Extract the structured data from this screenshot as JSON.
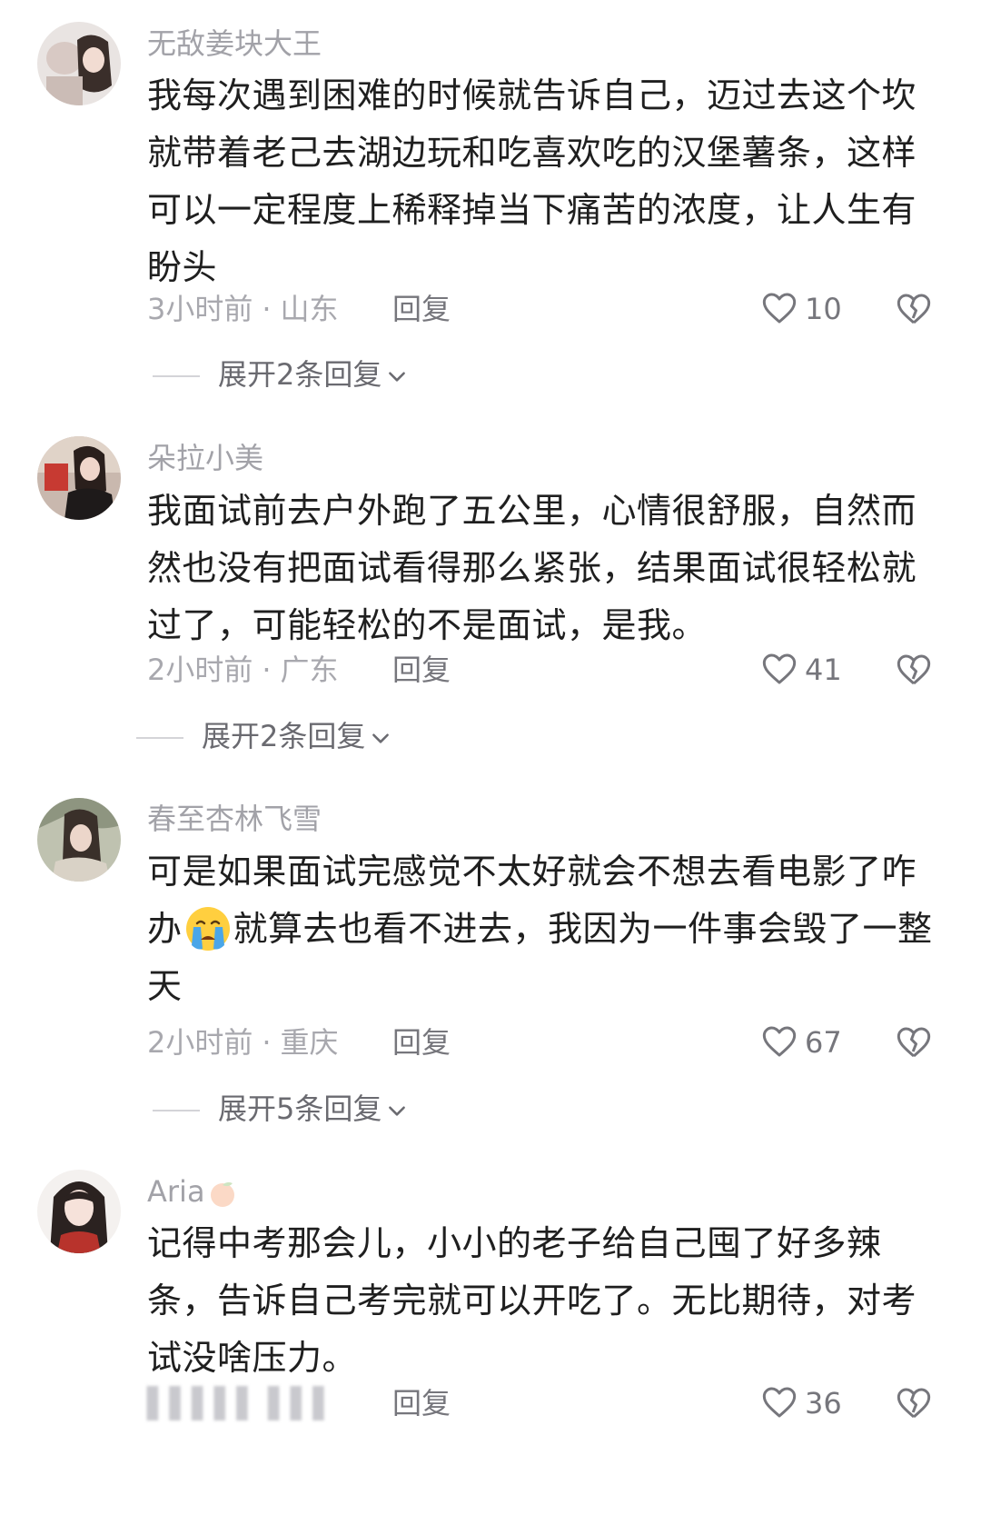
{
  "comments": [
    {
      "username": "无敌姜块大王",
      "text": "我每次遇到困难的时候就告诉自己，迈过去这个坎就带着老己去湖边玩和吃喜欢吃的汉堡薯条，这样可以一定程度上稀释掉当下痛苦的浓度，让人生有盼头",
      "time": "3小时前",
      "location": "山东",
      "reply_label": "回复",
      "likes": "10",
      "expand_label": "展开2条回复"
    },
    {
      "username": "朵拉小美",
      "text": "我面试前去户外跑了五公里，心情很舒服，自然而然也没有把面试看得那么紧张，结果面试很轻松就过了，可能轻松的不是面试，是我。",
      "time": "2小时前",
      "location": "广东",
      "reply_label": "回复",
      "likes": "41",
      "expand_label": "展开2条回复"
    },
    {
      "username": "春至杏林飞雪",
      "text_before_emoji": "可是如果面试完感觉不太好就会不想去看电影了咋办",
      "emoji": "crying-face-icon",
      "text_after_emoji": "就算去也看不进去，我因为一件事会毁了一整天",
      "time": "2小时前",
      "location": "重庆",
      "reply_label": "回复",
      "likes": "67",
      "expand_label": "展开5条回复"
    },
    {
      "username": "Aria",
      "username_icon": "peach-icon",
      "text": "记得中考那会儿，小小的老子给自己囤了好多辣条，告诉自己考完就可以开吃了。无比期待，对考试没啥压力。",
      "reply_label": "回复",
      "likes": "36"
    }
  ],
  "colors": {
    "text": "#1f1f1f",
    "meta": "#a8a8ae",
    "action": "#76767c",
    "background": "#ffffff"
  }
}
